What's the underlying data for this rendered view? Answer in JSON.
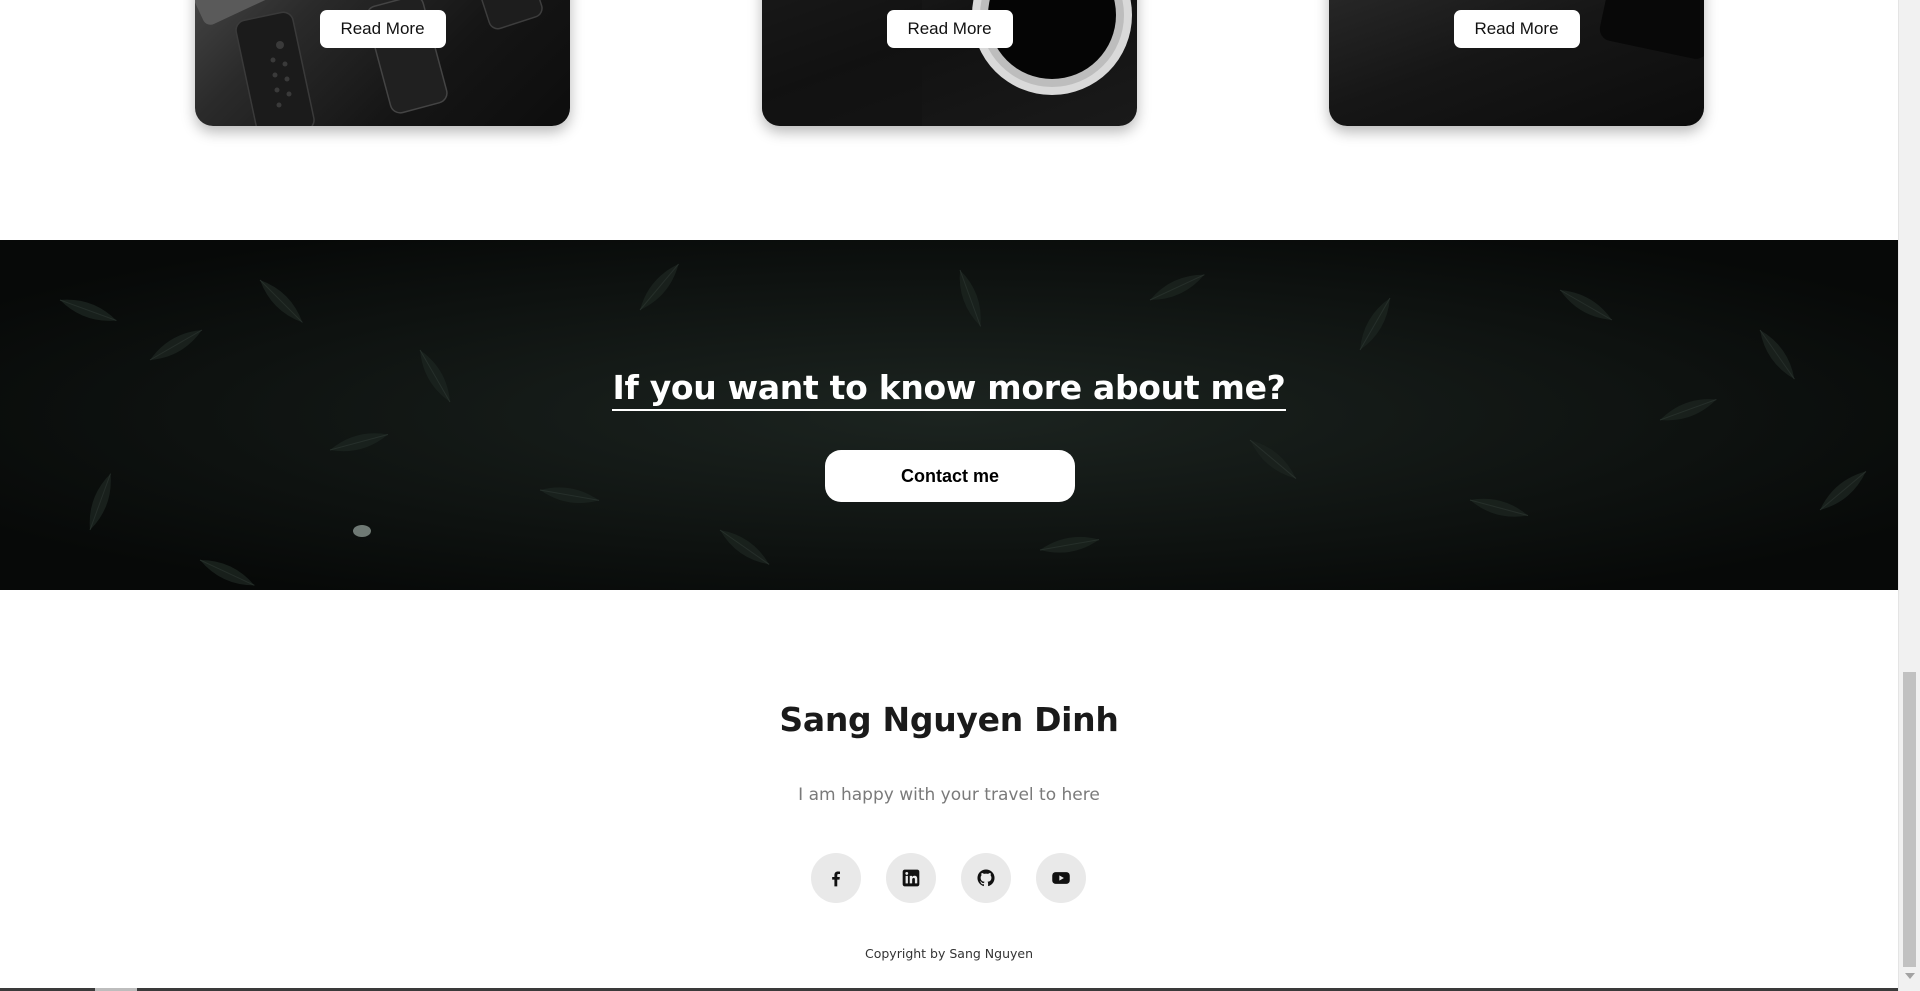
{
  "cards": [
    {
      "read_more_label": "Read More"
    },
    {
      "read_more_label": "Read More"
    },
    {
      "read_more_label": "Read More"
    }
  ],
  "cta": {
    "title": "If you want to know more about me?",
    "button_label": "Contact me"
  },
  "footer": {
    "name": "Sang Nguyen Dinh",
    "tagline": "I am happy with your travel to here",
    "social": [
      {
        "icon": "facebook-icon"
      },
      {
        "icon": "linkedin-icon"
      },
      {
        "icon": "github-icon"
      },
      {
        "icon": "youtube-icon"
      }
    ],
    "copyright": "Copyright by Sang Nguyen"
  },
  "colors": {
    "banner_background": "#0a0c0b",
    "social_button_bg": "#e9e9e9"
  }
}
